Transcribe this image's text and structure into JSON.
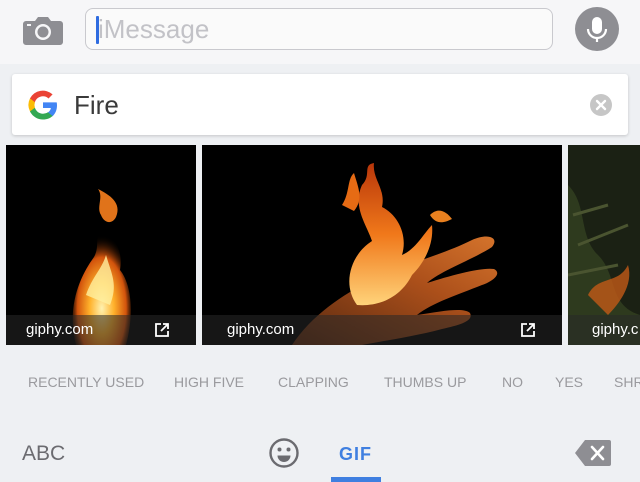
{
  "composer": {
    "placeholder": "iMessage"
  },
  "search": {
    "query": "Fire"
  },
  "results": [
    {
      "source": "giphy.com"
    },
    {
      "source": "giphy.com"
    },
    {
      "source": "giphy.c"
    }
  ],
  "categories": [
    "RECENTLY USED",
    "HIGH FIVE",
    "CLAPPING",
    "THUMBS UP",
    "NO",
    "YES",
    "SHR"
  ],
  "keyboard": {
    "abc_label": "ABC",
    "gif_label": "GIF"
  },
  "colors": {
    "accent": "#3f7fe0",
    "icon_gray": "#8e8e93"
  },
  "icons": [
    "camera-icon",
    "microphone-icon",
    "google-logo",
    "clear-icon",
    "external-link-icon",
    "emoji-icon",
    "backspace-icon"
  ]
}
